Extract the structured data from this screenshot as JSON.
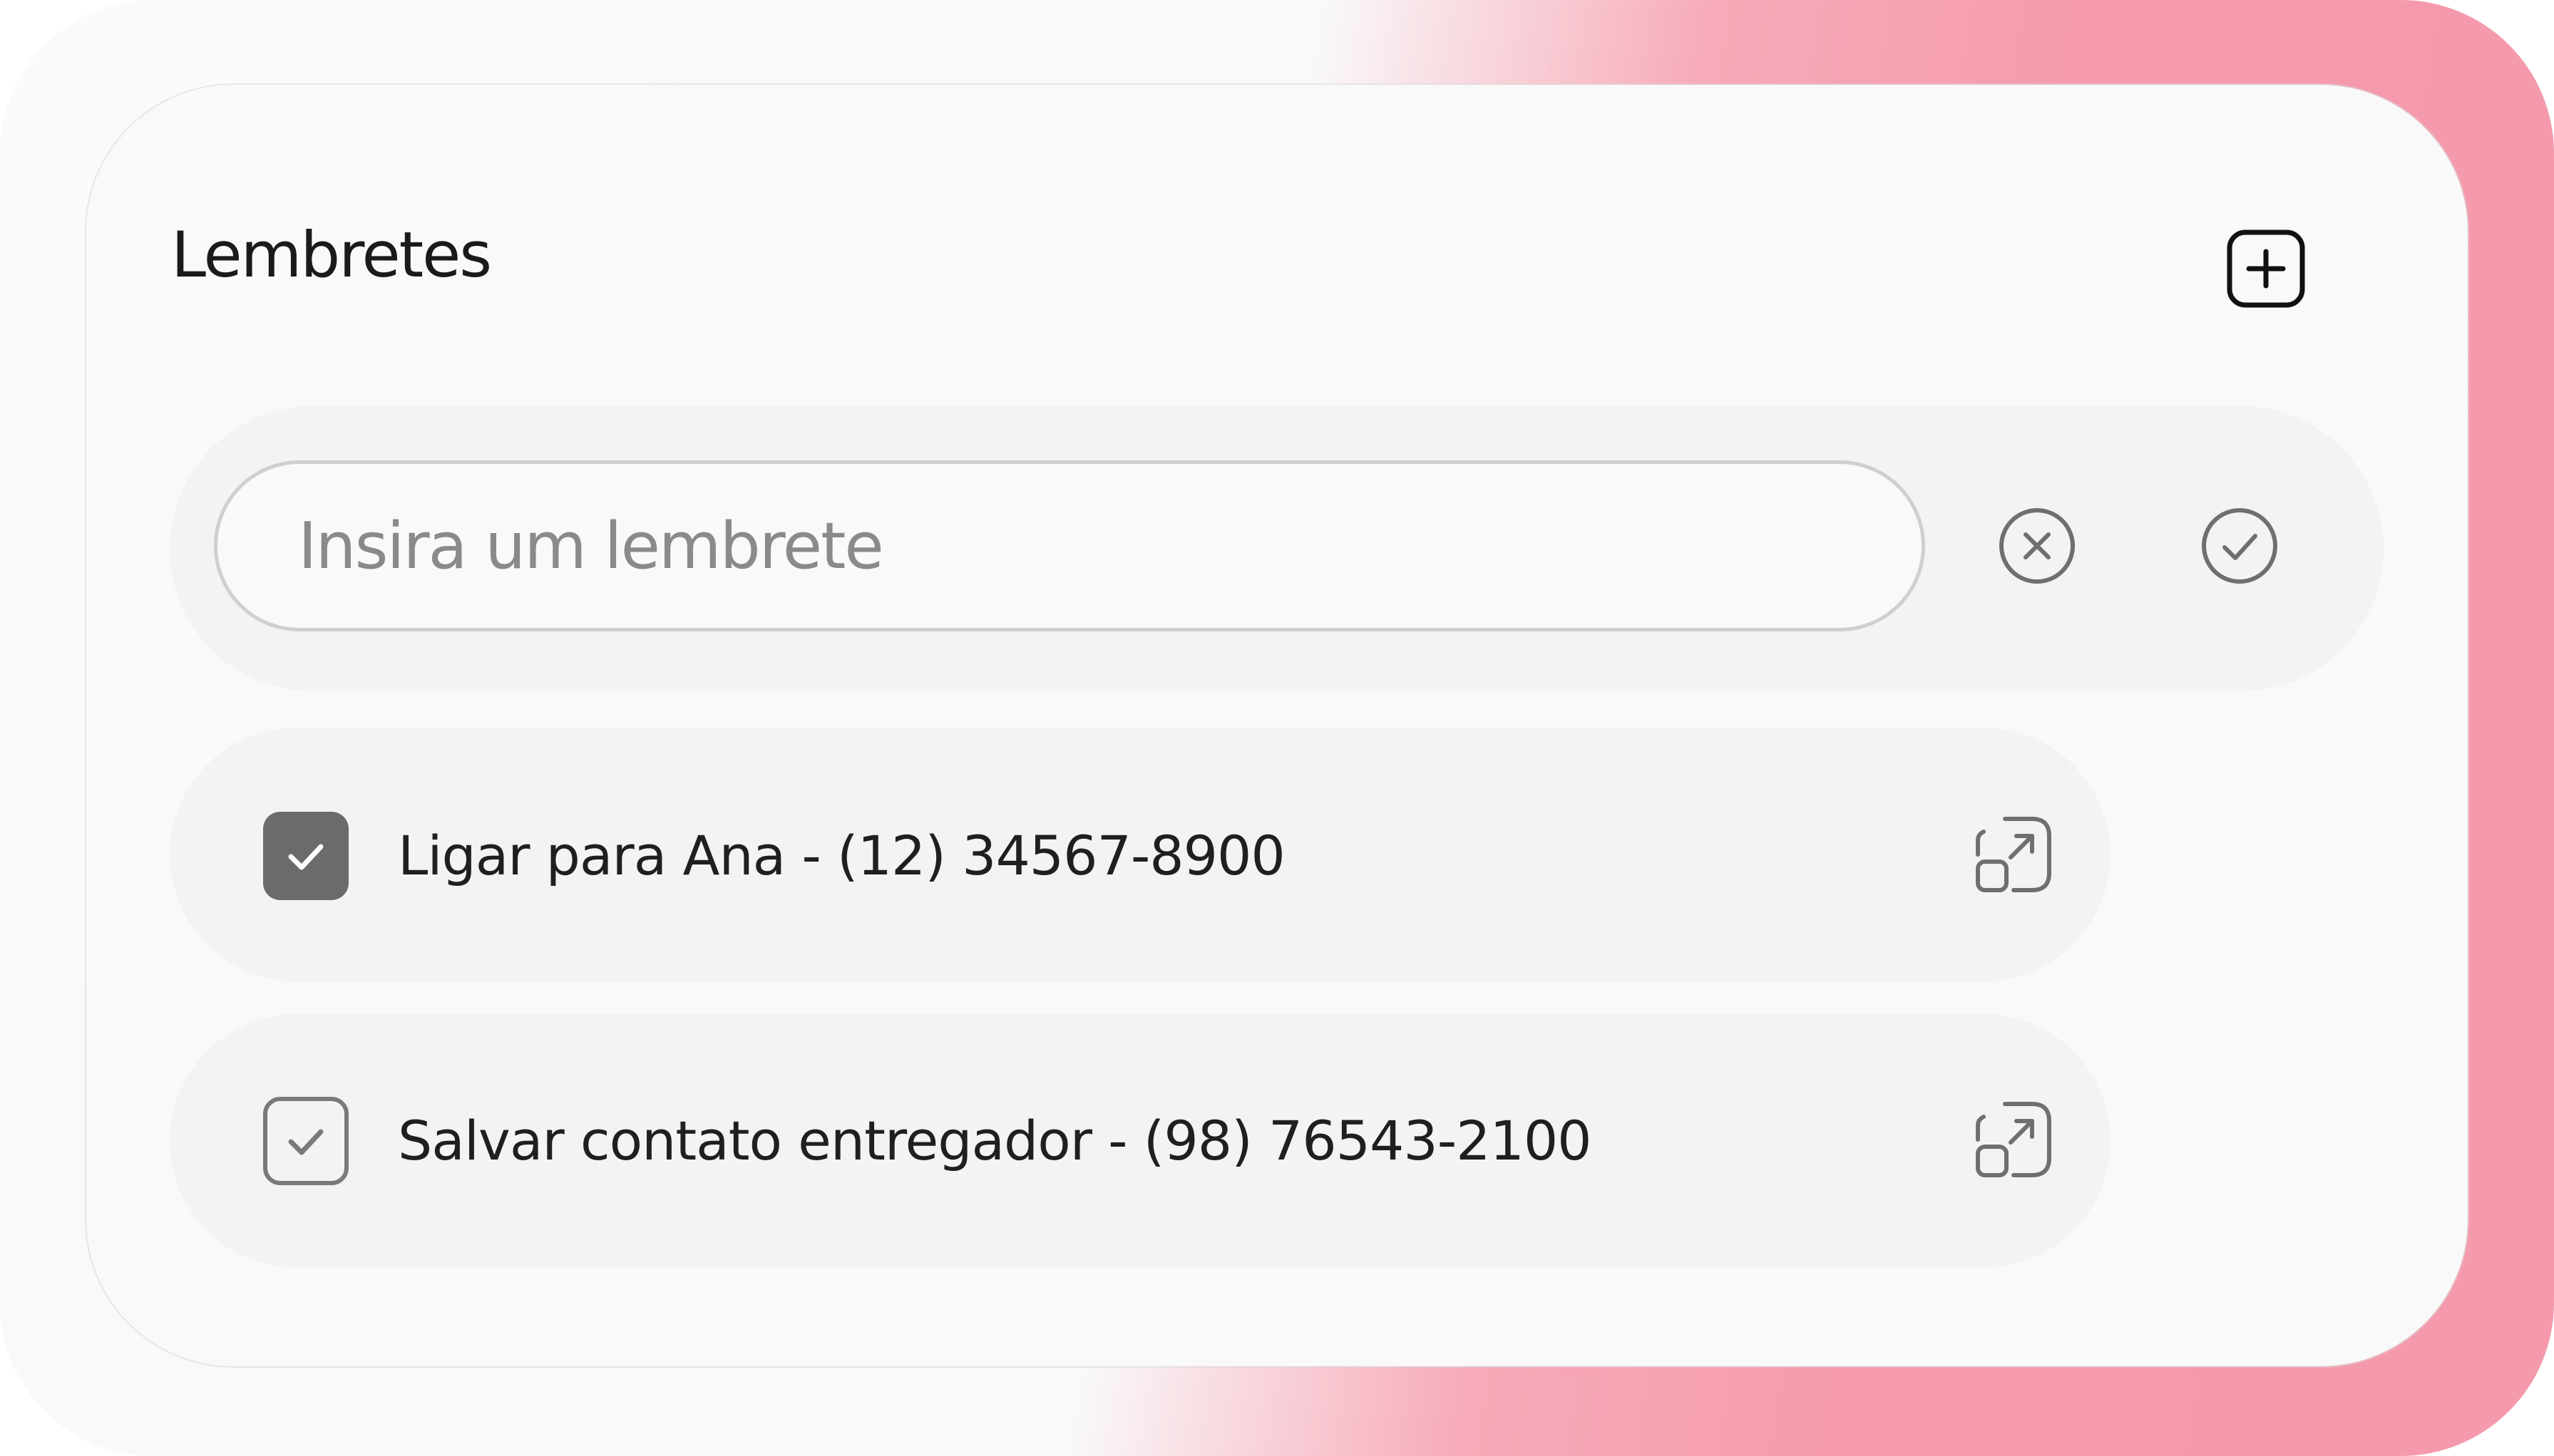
{
  "title": "Lembretes",
  "icons": {
    "add": "plus-square-icon",
    "cancel": "x-circle-icon",
    "confirm": "check-circle-icon",
    "checkbox": "check-icon",
    "open": "open-external-icon"
  },
  "input": {
    "placeholder": "Insira um lembrete",
    "value": ""
  },
  "reminders": [
    {
      "text": "Ligar para Ana - (12) 34567-8900",
      "checked": true
    },
    {
      "text": "Salvar contato entregador - (98) 76543-2100",
      "checked": false
    }
  ],
  "colors": {
    "accent_pink": "#f59bad",
    "card_bg": "#f9f9f9",
    "row_bg": "#f3f3f3",
    "checkbox_checked": "#6b6b6b",
    "icon_gray": "#6f6f6f",
    "text": "#1f1f1f"
  }
}
